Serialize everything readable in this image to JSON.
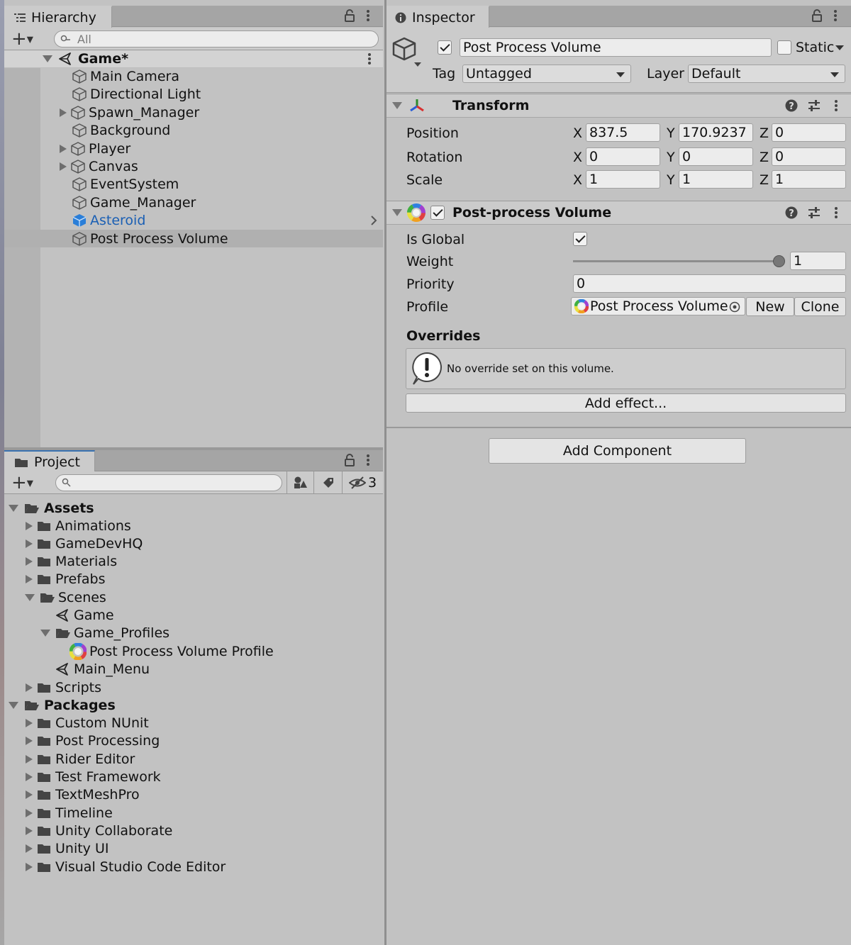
{
  "hierarchy": {
    "tab_label": "Hierarchy",
    "search_placeholder": "All",
    "scene": "Game*",
    "items": [
      {
        "label": "Main Camera"
      },
      {
        "label": "Directional Light"
      },
      {
        "label": "Spawn_Manager"
      },
      {
        "label": "Background"
      },
      {
        "label": "Player"
      },
      {
        "label": "Canvas"
      },
      {
        "label": "EventSystem"
      },
      {
        "label": "Game_Manager"
      },
      {
        "label": "Asteroid"
      },
      {
        "label": "Post Process Volume"
      }
    ]
  },
  "project": {
    "tab_label": "Project",
    "hidden_count": "3",
    "assets_label": "Assets",
    "asset_items": [
      "Animations",
      "GameDevHQ",
      "Materials",
      "Prefabs",
      "Scenes",
      "Game",
      "Game_Profiles",
      "Post Process Volume Profile",
      "Main_Menu",
      "Scripts"
    ],
    "packages_label": "Packages",
    "package_items": [
      "Custom NUnit",
      "Post Processing",
      "Rider Editor",
      "Test Framework",
      "TextMeshPro",
      "Timeline",
      "Unity Collaborate",
      "Unity UI",
      "Visual Studio Code Editor"
    ]
  },
  "inspector": {
    "tab_label": "Inspector",
    "object_name": "Post Process Volume",
    "static_label": "Static",
    "tag_label": "Tag",
    "tag_value": "Untagged",
    "layer_label": "Layer",
    "layer_value": "Default",
    "transform": {
      "title": "Transform",
      "position_label": "Position",
      "rotation_label": "Rotation",
      "scale_label": "Scale",
      "axis_x": "X",
      "axis_y": "Y",
      "axis_z": "Z",
      "position": {
        "x": "837.5",
        "y": "170.9237",
        "z": "0"
      },
      "rotation": {
        "x": "0",
        "y": "0",
        "z": "0"
      },
      "scale": {
        "x": "1",
        "y": "1",
        "z": "1"
      }
    },
    "ppv": {
      "title": "Post-process Volume",
      "is_global_label": "Is Global",
      "weight_label": "Weight",
      "weight_value": "1",
      "priority_label": "Priority",
      "priority_value": "0",
      "profile_label": "Profile",
      "profile_value": "Post Process Volume",
      "new_label": "New",
      "clone_label": "Clone",
      "overrides_label": "Overrides",
      "no_override_msg": "No override set on this volume.",
      "add_effect_label": "Add effect..."
    },
    "add_component_label": "Add Component"
  },
  "colors": {
    "selection_text": "#1a5fb4",
    "panel_bg": "#c2c2c2"
  }
}
